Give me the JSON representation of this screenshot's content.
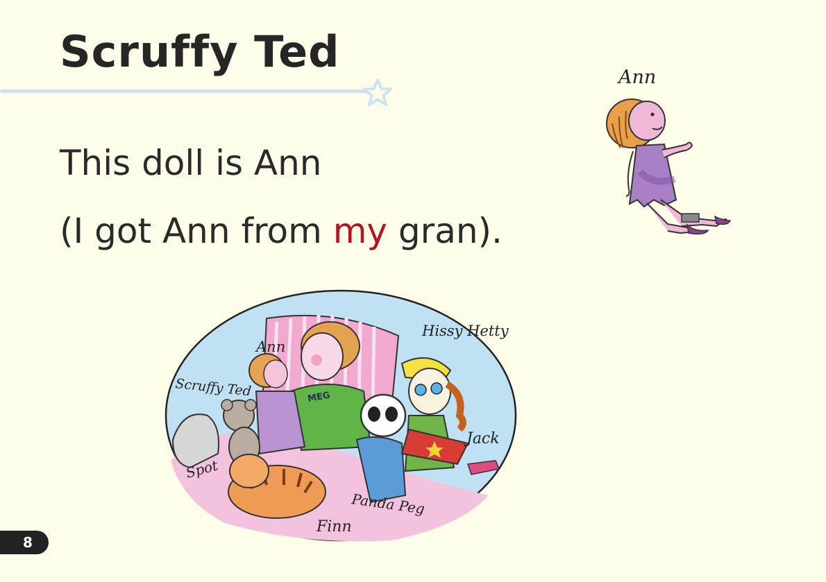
{
  "title": "Scruffy Ted",
  "text": {
    "line1": "This doll is Ann",
    "line2_before": "(I got Ann from ",
    "line2_highlight": "my",
    "line2_after": " gran)."
  },
  "doll_label": "Ann",
  "scene_labels": {
    "ann": "Ann",
    "scruffy_ted": "Scruffy Ted",
    "hissy_hetty": "Hissy Hetty",
    "jack": "Jack",
    "spot": "Spot",
    "panda_peg": "Panda Peg",
    "finn": "Finn",
    "jumper_text": "MEG"
  },
  "page_number": "8",
  "colors": {
    "background": "#fefde9",
    "highlight": "#b5141e",
    "rule": "#cfe2f4"
  }
}
